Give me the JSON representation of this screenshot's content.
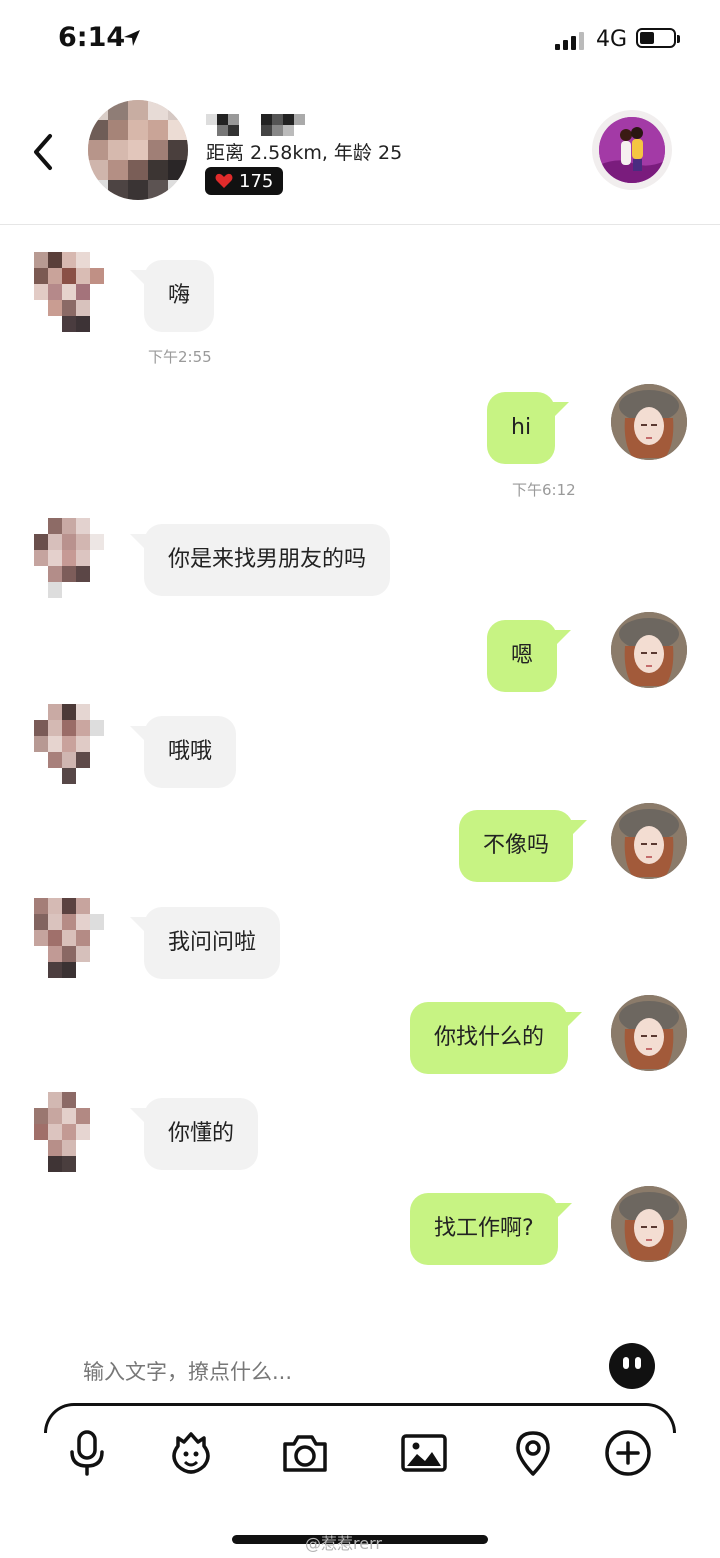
{
  "status_bar": {
    "time": "6:14",
    "network": "4G"
  },
  "header": {
    "distance_age": "距离 2.58km, 年龄 25",
    "likes": "175"
  },
  "messages": [
    {
      "side": "in",
      "text": "嗨",
      "time": "下午2:55"
    },
    {
      "side": "out",
      "text": "hi",
      "time": "下午6:12"
    },
    {
      "side": "in",
      "text": "你是来找男朋友的吗"
    },
    {
      "side": "out",
      "text": "嗯"
    },
    {
      "side": "in",
      "text": "哦哦"
    },
    {
      "side": "out",
      "text": "不像吗"
    },
    {
      "side": "in",
      "text": "我问问啦"
    },
    {
      "side": "out",
      "text": "你找什么的"
    },
    {
      "side": "in",
      "text": "你懂的"
    },
    {
      "side": "out",
      "text": "找工作啊?"
    }
  ],
  "input": {
    "placeholder": "输入文字，撩点什么..."
  },
  "toolbar": {
    "icons": [
      "microphone-icon",
      "gesture-icon",
      "camera-icon",
      "image-icon",
      "location-icon",
      "plus-icon"
    ]
  },
  "watermark": "@惹惹rerr",
  "colors": {
    "outgoing_bubble": "#c7f383",
    "incoming_bubble": "#f2f2f2",
    "badge": "#111111",
    "heart": "#e02b2b"
  }
}
